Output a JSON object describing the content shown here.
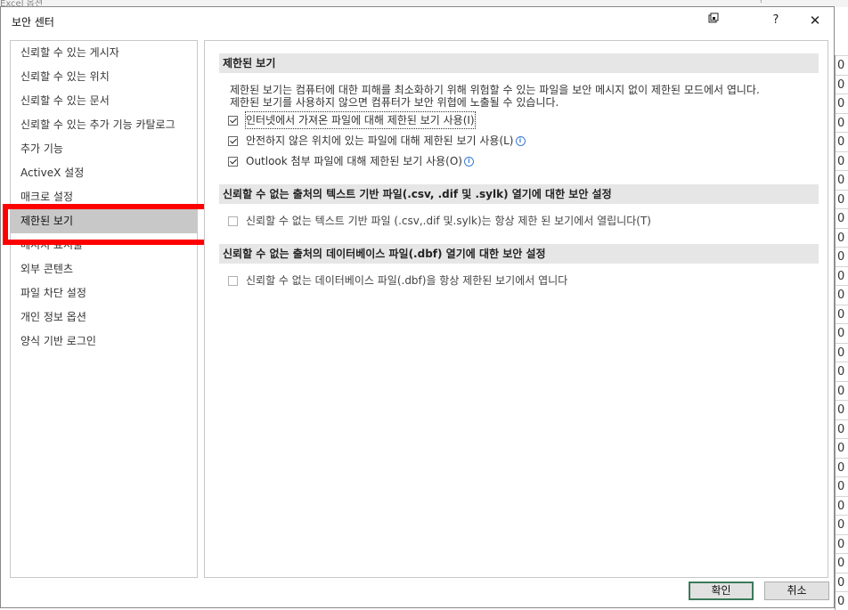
{
  "background": {
    "title": "Excel 옵션",
    "help": "?",
    "cell_char": "0"
  },
  "dialog": {
    "title": "보안 센터",
    "titlebar": {
      "restore_icon": "window-restore-icon",
      "help_label": "?",
      "close_label": "✕"
    }
  },
  "nav": {
    "items": [
      {
        "label": "신뢰할 수 있는 게시자"
      },
      {
        "label": "신뢰할 수 있는 위치"
      },
      {
        "label": "신뢰할 수 있는 문서"
      },
      {
        "label": "신뢰할 수 있는 추가 기능 카탈로그"
      },
      {
        "label": "추가 기능"
      },
      {
        "label": "ActiveX 설정"
      },
      {
        "label": "매크로 설정"
      },
      {
        "label": "제한된 보기"
      },
      {
        "label": "메시지 표시줄"
      },
      {
        "label": "외부 콘텐츠"
      },
      {
        "label": "파일 차단 설정"
      },
      {
        "label": "개인 정보 옵션"
      },
      {
        "label": "양식 기반 로그인"
      }
    ],
    "selected": "제한된 보기"
  },
  "protected_view": {
    "header": "제한된 보기",
    "desc_line1": "제한된 보기는 컴퓨터에 대한 피해를 최소화하기 위해 위험할 수 있는 파일을 보안 메시지 없이 제한된 모드에서 엽니다.",
    "desc_line2": "제한된 보기를 사용하지 않으면 컴퓨터가 보안 위협에 노출될 수 있습니다.",
    "options": [
      {
        "label": "인터넷에서 가져온 파일에 대해 제한된 보기 사용(I)",
        "checked": true
      },
      {
        "label": "안전하지 않은 위치에 있는 파일에 대해 제한된 보기 사용(L)",
        "checked": true
      },
      {
        "label": "Outlook 첨부 파일에 대해 제한된 보기 사용(O)",
        "checked": true
      }
    ]
  },
  "text_files": {
    "header": "신뢰할 수 없는 출처의 텍스트 기반 파일(.csv, .dif 및 .sylk) 열기에 대한 보안 설정",
    "option": "신뢰할 수 없는 텍스트 기반 파일 (.csv,.dif 및.sylk)는 항상 제한 된 보기에서 열립니다(T)"
  },
  "db_files": {
    "header": "신뢰할 수 없는 출처의 데이터베이스 파일(.dbf) 열기에 대한 보안 설정",
    "option": "신뢰할 수 없는 데이터베이스 파일(.dbf)을 항상 제한된 보기에서 엽니다"
  },
  "buttons": {
    "ok": "확인",
    "cancel": "취소"
  },
  "colors": {
    "highlight": "#ff0000",
    "selected_bg": "#c8c8c8",
    "section_bg": "#e6e6e6"
  }
}
